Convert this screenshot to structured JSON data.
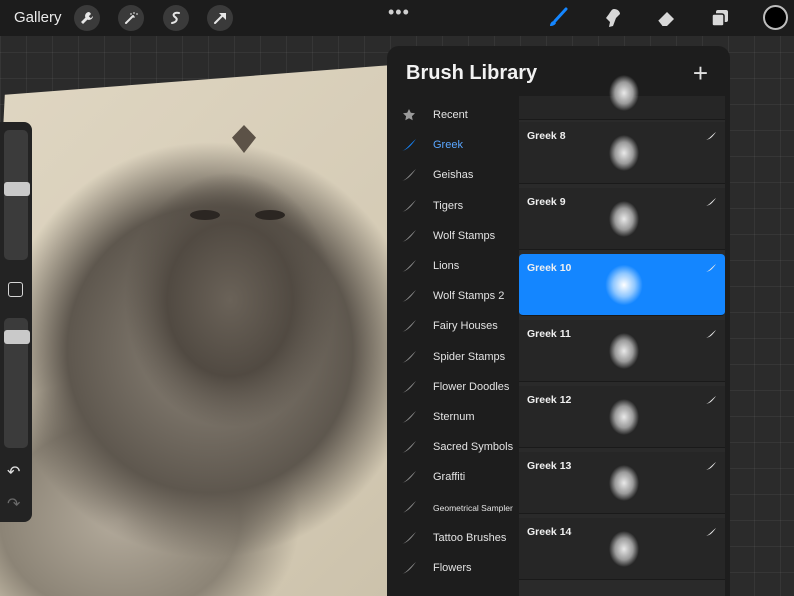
{
  "toolbar": {
    "gallery_label": "Gallery",
    "left_tools": [
      "wrench-icon",
      "magic-wand-icon",
      "selection-icon",
      "transform-icon"
    ],
    "right_tools": [
      "brush-icon",
      "smudge-icon",
      "eraser-icon",
      "layers-icon"
    ],
    "active_tool": "brush-icon",
    "current_color": "#000000",
    "accent_color": "#1486ff"
  },
  "library": {
    "title": "Brush Library",
    "add_symbol": "+",
    "sets": [
      {
        "label": "Recent",
        "icon": "star-icon"
      },
      {
        "label": "Greek",
        "icon": "brush-stroke-icon",
        "active": true
      },
      {
        "label": "Geishas",
        "icon": "brush-stroke-icon"
      },
      {
        "label": "Tigers",
        "icon": "brush-stroke-icon"
      },
      {
        "label": "Wolf Stamps",
        "icon": "brush-stroke-icon"
      },
      {
        "label": "Lions",
        "icon": "brush-stroke-icon"
      },
      {
        "label": "Wolf Stamps 2",
        "icon": "brush-stroke-icon"
      },
      {
        "label": "Fairy Houses",
        "icon": "brush-stroke-icon"
      },
      {
        "label": "Spider Stamps",
        "icon": "brush-stroke-icon"
      },
      {
        "label": "Flower Doodles",
        "icon": "brush-stroke-icon"
      },
      {
        "label": "Sternum",
        "icon": "brush-stroke-icon"
      },
      {
        "label": "Sacred Symbols",
        "icon": "brush-stroke-icon"
      },
      {
        "label": "Graffiti",
        "icon": "brush-stroke-icon"
      },
      {
        "label": "Geometrical Sampler",
        "icon": "brush-stroke-icon"
      },
      {
        "label": "Tattoo Brushes",
        "icon": "brush-stroke-icon"
      },
      {
        "label": "Flowers",
        "icon": "brush-stroke-icon"
      }
    ],
    "brushes": [
      {
        "name": "Greek 8"
      },
      {
        "name": "Greek 9"
      },
      {
        "name": "Greek 10",
        "selected": true
      },
      {
        "name": "Greek 11"
      },
      {
        "name": "Greek 12"
      },
      {
        "name": "Greek 13"
      },
      {
        "name": "Greek 14"
      }
    ]
  },
  "sidebar": {
    "size_level": 0.55,
    "opacity_level": 0.9
  }
}
